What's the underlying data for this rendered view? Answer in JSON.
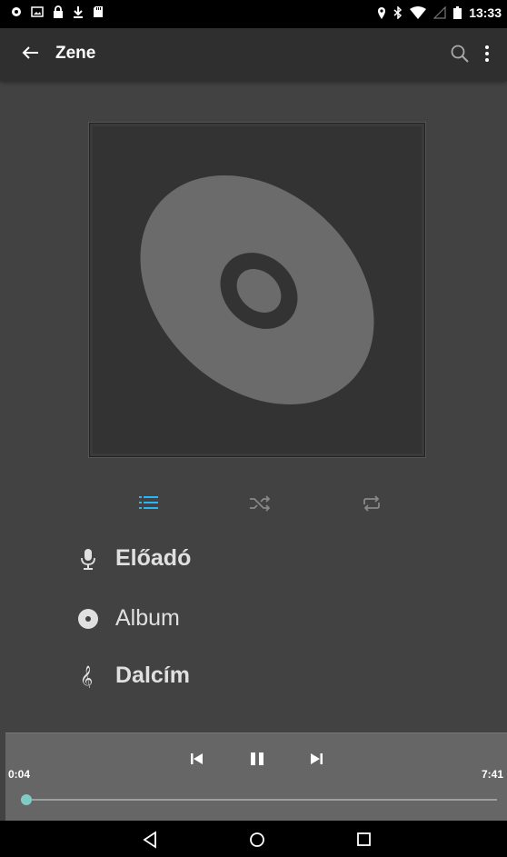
{
  "status_bar": {
    "time": "13:33",
    "left_icons": [
      "notification-dot-icon",
      "image-icon",
      "lock-icon",
      "download-icon",
      "sd-card-icon"
    ],
    "right_icons": [
      "location-icon",
      "bluetooth-icon",
      "wifi-icon",
      "signal-icon",
      "battery-icon"
    ]
  },
  "app_bar": {
    "title": "Zene",
    "actions": [
      "search-icon",
      "more-vert-icon"
    ]
  },
  "album_art": {
    "icon": "disc-icon"
  },
  "playback_modes": {
    "items": [
      "queue-list-icon",
      "shuffle-icon",
      "repeat-icon"
    ],
    "active_color": "#29b6f6"
  },
  "track": {
    "artist": "Előadó",
    "album": "Album",
    "title": "Dalcím"
  },
  "player": {
    "elapsed": "0:04",
    "duration": "7:41",
    "progress_fraction": 0.009,
    "accent": "#80cbc4"
  },
  "nav_bar": {
    "buttons": [
      "back-triangle-icon",
      "home-circle-icon",
      "recents-square-icon"
    ]
  }
}
